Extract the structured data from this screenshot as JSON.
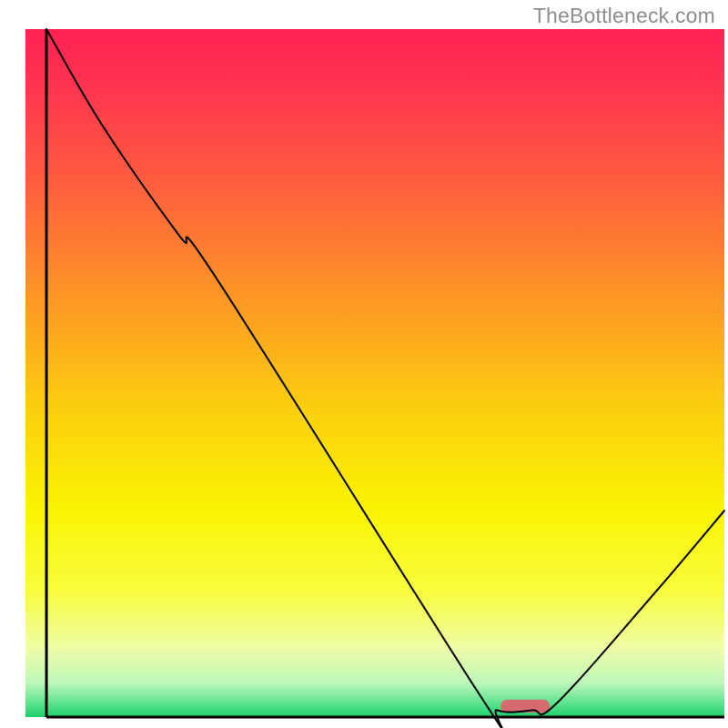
{
  "watermark": "TheBottleneck.com",
  "chart_data": {
    "type": "line",
    "title": "",
    "xlabel": "",
    "ylabel": "",
    "xlim": [
      0,
      100
    ],
    "ylim": [
      0,
      100
    ],
    "legend": false,
    "grid": false,
    "background_gradient_stops": [
      {
        "offset": 0.0,
        "color": "#ff2254"
      },
      {
        "offset": 0.08,
        "color": "#ff3350"
      },
      {
        "offset": 0.22,
        "color": "#fe5c3f"
      },
      {
        "offset": 0.38,
        "color": "#fd9327"
      },
      {
        "offset": 0.55,
        "color": "#fcce0e"
      },
      {
        "offset": 0.7,
        "color": "#faf403"
      },
      {
        "offset": 0.82,
        "color": "#f8fd40"
      },
      {
        "offset": 0.9,
        "color": "#effda7"
      },
      {
        "offset": 0.95,
        "color": "#bef7b9"
      },
      {
        "offset": 0.98,
        "color": "#5de28e"
      },
      {
        "offset": 1.0,
        "color": "#1dcf6b"
      }
    ],
    "series": [
      {
        "name": "bottleneck-curve",
        "color": "#000000",
        "stroke_width": 2,
        "points": [
          {
            "x": 3.0,
            "y": 100.0
          },
          {
            "x": 11.0,
            "y": 86.0
          },
          {
            "x": 22.0,
            "y": 70.0
          },
          {
            "x": 27.5,
            "y": 63.5
          },
          {
            "x": 64.5,
            "y": 4.0
          },
          {
            "x": 67.5,
            "y": 1.0
          },
          {
            "x": 72.5,
            "y": 1.0
          },
          {
            "x": 76.0,
            "y": 2.0
          },
          {
            "x": 90.0,
            "y": 18.0
          },
          {
            "x": 100.0,
            "y": 30.0
          }
        ]
      }
    ],
    "marker": {
      "name": "optimal-range-pill",
      "center_x": 71.5,
      "center_y": 1.6,
      "width": 7.0,
      "height": 1.9,
      "color": "#d56a6f"
    },
    "axes": {
      "left": {
        "x": 3.0,
        "y1": 0.0,
        "y2": 100.0
      },
      "bottom": {
        "y": 0.0,
        "x1": 3.0,
        "x2": 100.0
      }
    }
  }
}
